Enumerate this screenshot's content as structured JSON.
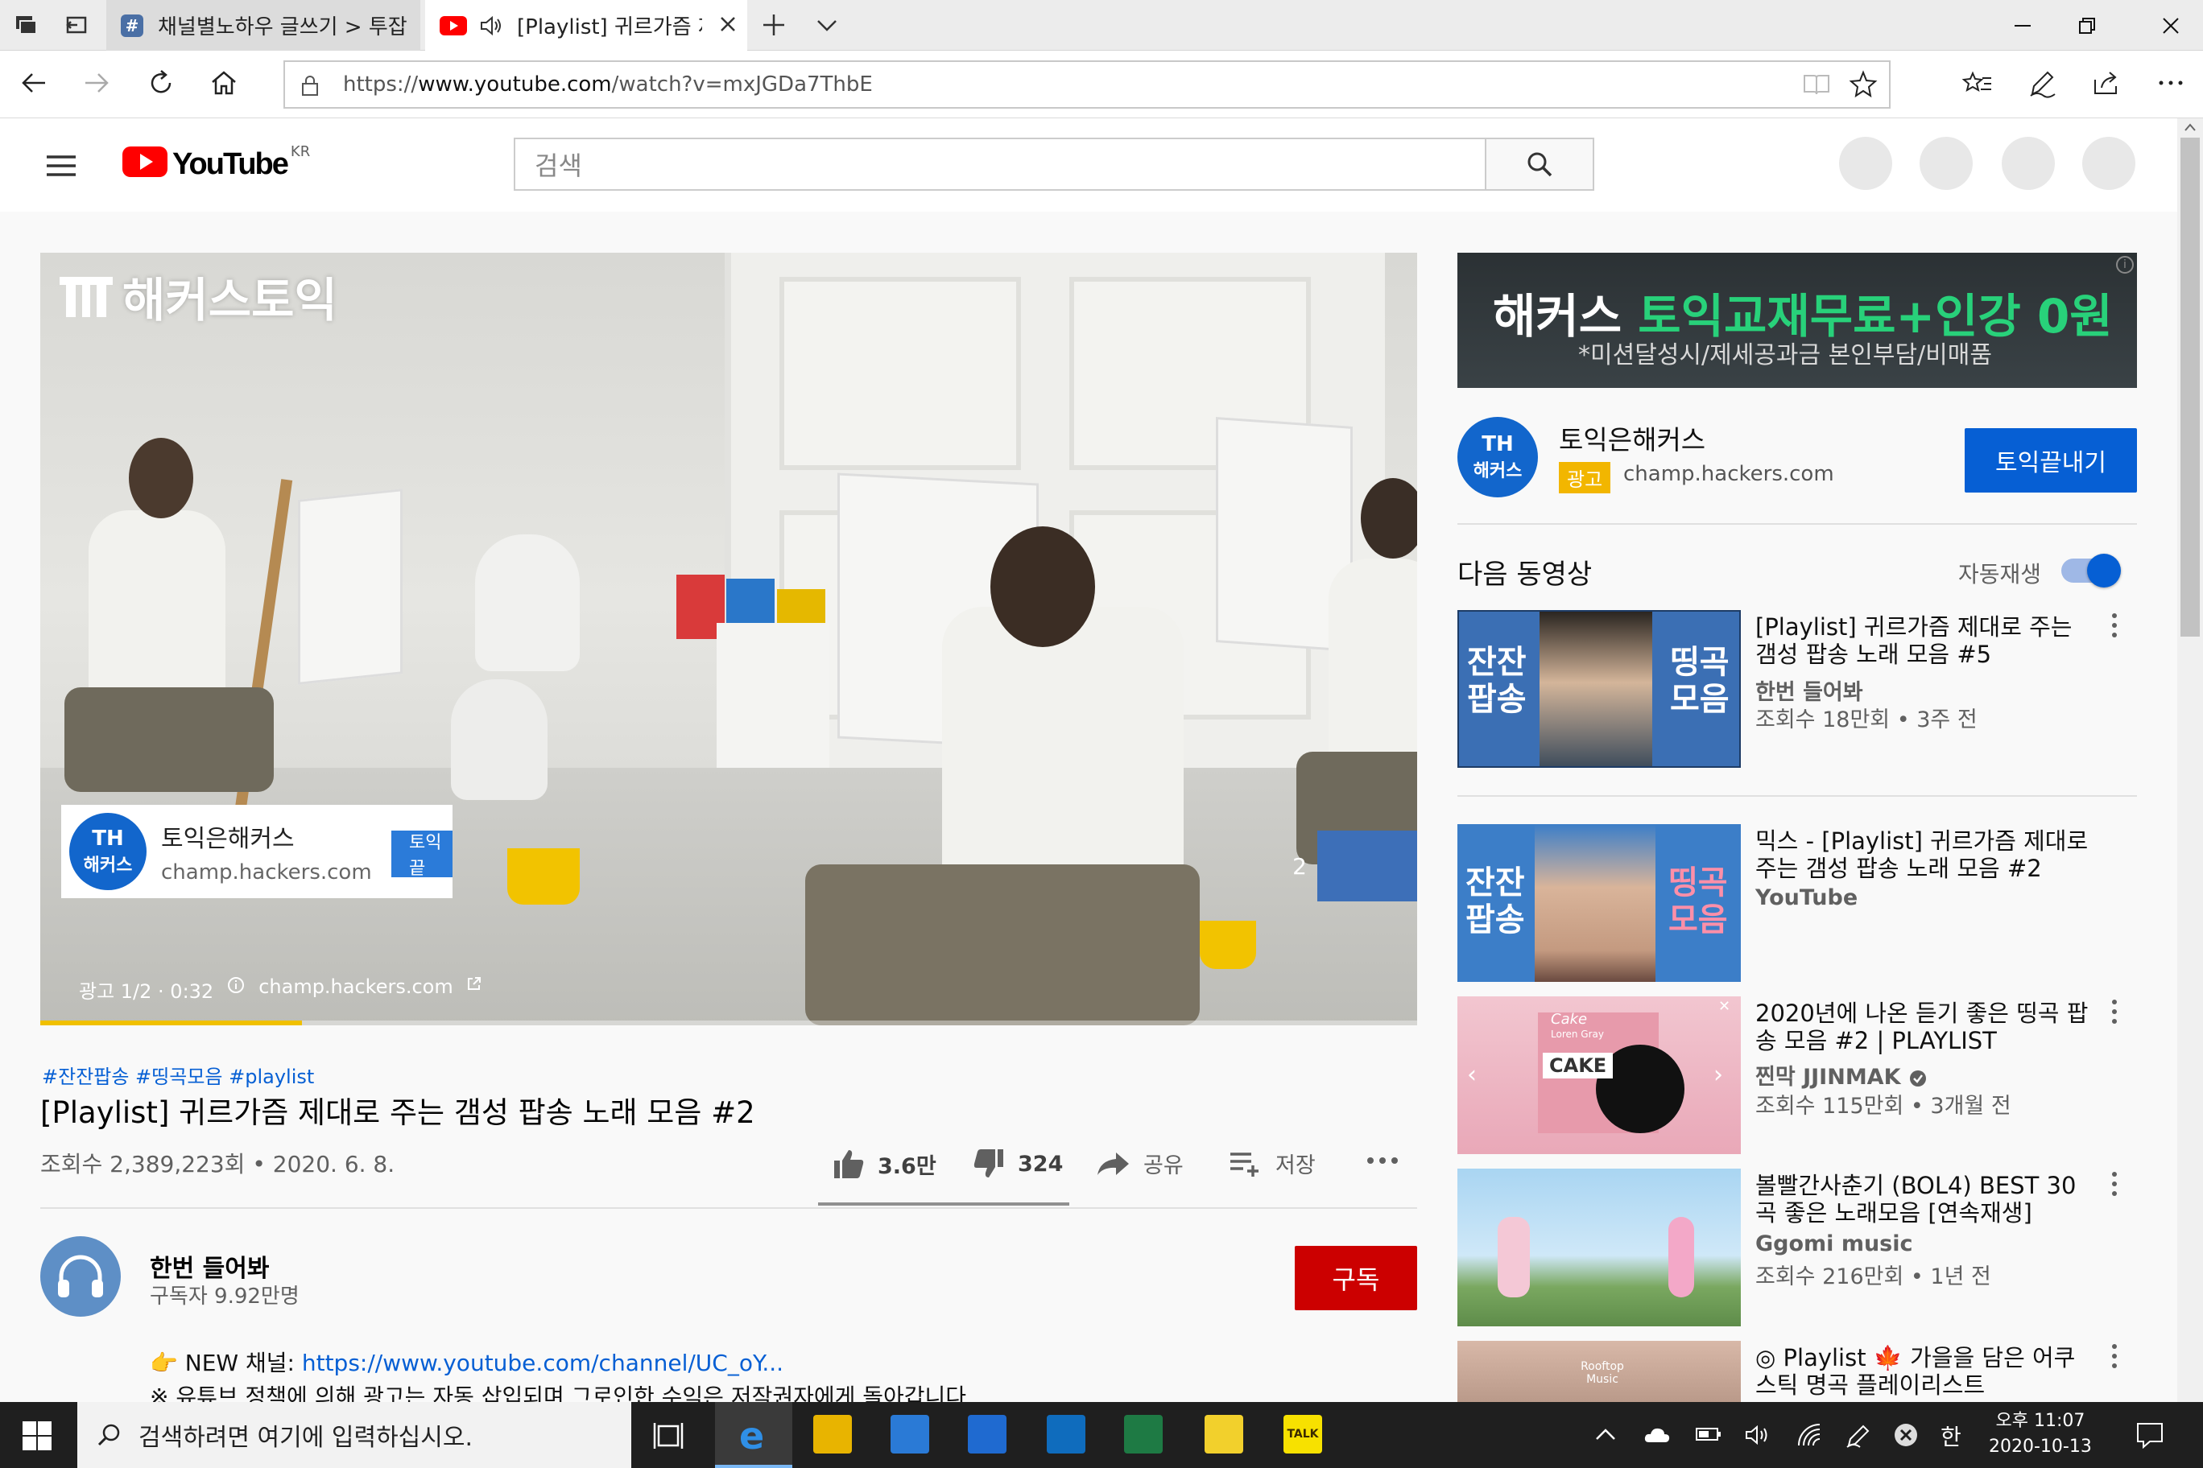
{
  "browser": {
    "tabs": [
      {
        "label": "채널별노하우 글쓰기 > 투잡",
        "favicon": "#"
      },
      {
        "label": "[Playlist] 귀르가즘 제"
      }
    ],
    "url_prefix": "https://",
    "url_domain": "www.youtube.com",
    "url_path": "/watch?v=mxJGDa7ThbE"
  },
  "youtube": {
    "logo_text": "YouTube",
    "region": "KR",
    "search_placeholder": "검색"
  },
  "player": {
    "ad_brand_logo": "해커스토익",
    "ad_card_logo_line1": "TH",
    "ad_card_logo_line2": "해커스",
    "ad_card_title": "토익은해커스",
    "ad_card_url": "champ.hackers.com",
    "ad_card_button": "토익끝",
    "ad_info": "광고 1/2 · 0:32",
    "ad_info_url": "champ.hackers.com",
    "next_index": "2",
    "ad_progress": 0.19
  },
  "video": {
    "hashtags": "#잔잔팝송 #띵곡모음 #playlist",
    "title": "[Playlist] 귀르가즘 제대로 주는 갬성 팝송 노래 모음 #2",
    "meta": "조회수 2,389,223회 • 2020. 6. 8.",
    "likes": "3.6만",
    "dislikes": "324",
    "share": "공유",
    "save": "저장"
  },
  "channel": {
    "name": "한번 들어봐",
    "subs": "구독자 9.92만명",
    "subscribe": "구독",
    "desc_prefix": "👉 NEW 채널: ",
    "desc_link": "https://www.youtube.com/channel/UC_oY...",
    "desc_line2": "※ 유튜브 정책에 의해 광고는 자동 삽입되며 그로인한 수익은 저작권자에게 돌아갑니다"
  },
  "sidebar_ad": {
    "banner_prefix": "해커스 ",
    "banner_highlight": "토익교재무료+인강 0원",
    "banner_sub": "*미션달성시/제세공과금 본인부담/비매품",
    "logo_line1": "TH",
    "logo_line2": "해커스",
    "title": "토익은해커스",
    "badge": "광고",
    "url": "champ.hackers.com",
    "button": "토익끝내기"
  },
  "up_next": {
    "heading": "다음 동영상",
    "autoplay_label": "자동재생",
    "autoplay_on": true
  },
  "recommendations": [
    {
      "title": "[Playlist] 귀르가즘 제대로 주는 갬성 팝송 노래 모음 #5",
      "channel": "한번 들어봐",
      "views": "조회수 18만회 • 3주 전",
      "thumb_left": "잔잔 팝송",
      "thumb_right": "띵곡 모음"
    },
    {
      "title": "믹스 - [Playlist] 귀르가즘 제대로 주는 갬성 팝송 노래 모음 #2",
      "channel": "YouTube",
      "views": "",
      "thumb_left": "잔잔 팝송",
      "thumb_right": "띵곡 모음"
    },
    {
      "title": "2020년에 나온 듣기 좋은 띵곡 팝송 모음 #2 | PLAYLIST",
      "channel": "찐막 JJINMAK",
      "views": "조회수 115만회 • 3개월 전",
      "thumb_word": "Cake",
      "thumb_sub": "Loren Gray",
      "thumb_cake": "CAKE"
    },
    {
      "title": "볼빨간사춘기 (BOL4) BEST 30곡 좋은 노래모음 [연속재생]",
      "channel": "Ggomi music",
      "views": "조회수 216만회 • 1년 전"
    },
    {
      "title": "◎ Playlist 🍁 가을을 담은 어쿠스틱 명곡 플레이리스트",
      "channel": "",
      "views": "",
      "thumb_word": "Rooftop Music"
    }
  ],
  "taskbar": {
    "search_placeholder": "검색하려면 여기에 입력하십시오.",
    "time": "오후 11:07",
    "date": "2020-10-13",
    "ime": "한",
    "kakao_label": "TALK"
  }
}
